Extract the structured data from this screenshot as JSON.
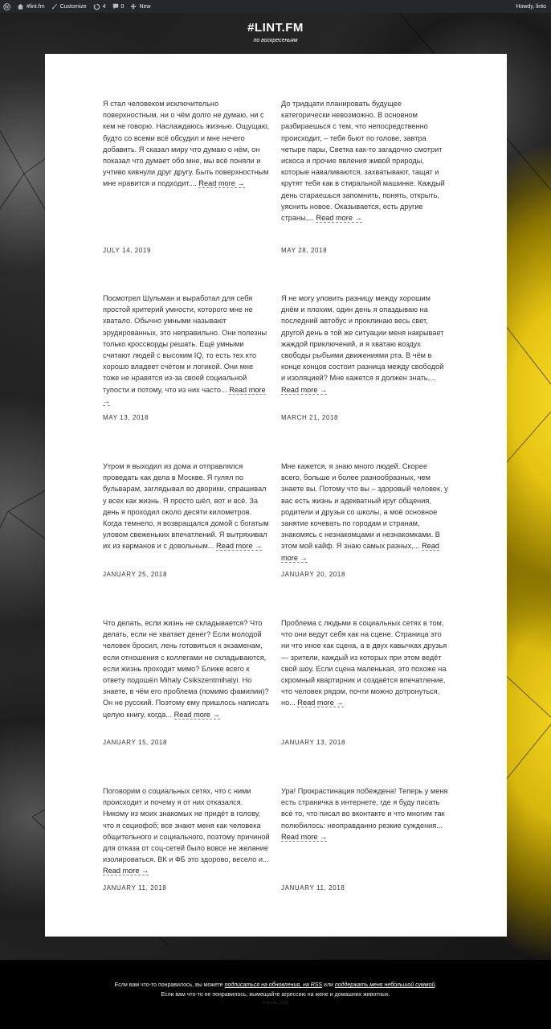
{
  "admin_bar": {
    "site_name": "#lint.fm",
    "customize": "Customize",
    "updates": "4",
    "comments": "0",
    "new": "New",
    "greeting": "Howdy, linto"
  },
  "site": {
    "title": "#LINT.FM",
    "description": "по воскресеньям"
  },
  "posts": [
    {
      "excerpt": "Я стал человеком исключительно поверхностным, ни о чём долго не думаю, ни с кем не говорю. Наслаждаюсь жизнью. Ощущаю, будто со всеми всё обсудил и мне нечего добавить. Я сказал миру что думаю о нём, он показал что думает обо мне, мы всё поняли и учтиво кивнули друг другу. Быть поверхностным мне нравится и подходит....",
      "read_more": "Read more →",
      "date": "JULY 14, 2019"
    },
    {
      "excerpt": "До тридцати планировать будущее категорически невозможно. В основном разбираешься с тем, что непосредственно происходит, – тебя бьют по голове, завтра четыре пары, Светка как-то загадочно смотрит искоса и прочие явления живой природы, которые наваливаются, захватывают, тащат и крутят тебя как в стиральной машинке. Каждый день стараешься запомнить, понять, открыть, уяснить новое. Оказывается, есть другие страны,...",
      "read_more": "Read more →",
      "date": "MAY 28, 2018"
    },
    {
      "excerpt": "Посмотрел Шульман и выработал для себя простой критерий умности, которого мне не хватало. Обычно умными называют эрудированных, это неправильно. Они полезны только кроссворды решать. Ещё умными считают людей с высоким IQ, то есть тех кто хорошо владеет счётом и логикой. Они мне тоже не нравятся из-за своей социальной тупости и потому, что из них часто...",
      "read_more": "Read more →",
      "date": "MAY 13, 2018"
    },
    {
      "excerpt": "Я не могу уловить разницу между хорошим днём и плохим, один день я опаздываю на последний автобус и проклинаю весь свет, другой день в той же ситуации меня накрывает жаждой приключений, и я хватаю воздух свободы рыбьими движениями рта. В чём в конце концов состоит разница между свободой и изоляцией? Мне кажется я должен знать,...",
      "read_more": "Read more →",
      "date": "MARCH 21, 2018"
    },
    {
      "excerpt": "Утром я выходил из дома и отправлялся проведать как дела в Москве. Я гулял по бульварам, заглядывал во дворики, спрашивал у всех как жизнь. Я просто шёл, вот и всё. За день я проходил около десяти километров. Когда темнело, я возвращался домой с богатым уловом свеженьких впечатлений. Я вытряхивал их из карманов и с довольным...",
      "read_more": "Read more →",
      "date": "JANUARY 25, 2018"
    },
    {
      "excerpt": "Мне кажется, я знаю много людей. Скорее всего, больше и более разнообразных, чем знаете вы. Потому что вы – здоровый человек, у вас есть жизнь и адекватный круг общения, родители и друзья со школы, а моё основное занятие кочевать по городам и странам, знакомясь с незнакомцами и незнакомками. В этом мой кайф. Я знаю самых разных,...",
      "read_more": "Read more →",
      "date": "JANUARY 20, 2018"
    },
    {
      "excerpt": "Что делать, если жизнь не складывается? Что делать, если не хватает денег? Если молодой человек бросил, лень готовиться к экзаменам, если отношения с коллегами не складываются, если жизнь проходит мимо? Ближе всего к ответу подошёл Mihaly Csikszentmihalyi. Но знаете, в чём его проблема (помимо фамилии)? Он не русский. Поэтому ему пришлось написать целую книгу, когда...",
      "read_more": "Read more →",
      "date": "JANUARY 15, 2018"
    },
    {
      "excerpt": "Проблема с людьми в социальных сетях в том, что они ведут себя как на сцене. Страница это ни что иное как сцена, а в двух кавычках друзья — зрители, каждый из которых при этом ведёт свой шоу. Если сцена маленькая, это похоже на скромный квартирник и создаётся впечатление, что человек рядом, почти можно дотронуться, но...",
      "read_more": "Read more →",
      "date": "JANUARY 13, 2018"
    },
    {
      "excerpt": "Поговорим о социальных сетях, что с ними происходит и почему я от них отказался. Никому из моих знакомых не придёт в голову, что я социофоб; все знают меня как человека общительного и социального, поэтому причиной для отказа от соц-сетей было вовсе не желание изолироваться. ВК и ФБ это здорово, весело и...",
      "read_more": "Read more →",
      "date": "JANUARY 11, 2018"
    },
    {
      "excerpt": "Ура! Прокрастинация побеждена! Теперь у меня есть страничка в интернете, где я буду писать всё то, что писал во вконтакте и что многим так полюбилось: неоправданно резкие суждения...",
      "read_more": "Read more →",
      "date": "JANUARY 11, 2018"
    }
  ],
  "footer": {
    "line1_prefix": "Если вам что-то понравилось, вы можете ",
    "subscribe_link": "подписаться на обновления, на RSS",
    "line1_middle": " или ",
    "support_link": "поддержать меня небольшой суммой",
    "line1_suffix": ".",
    "line2": "Если вам что-то не понравилось, вымещайте агрессию на жене и домашних животных.",
    "line3": "© lint.fm, 2018"
  }
}
